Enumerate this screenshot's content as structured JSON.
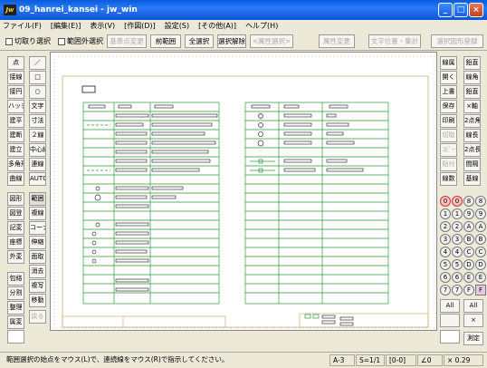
{
  "title": "09_hanrei_kansei - jw_win",
  "app_icon": "Jw",
  "window_buttons": {
    "minimize": "_",
    "maximize": "□",
    "close": "×"
  },
  "menu": [
    "ファイル(F)",
    "[編集(E)]",
    "表示(V)",
    "[作図(D)]",
    "設定(S)",
    "[その他(A)]",
    "ヘルプ(H)"
  ],
  "toolbar": {
    "cut_chk": "切取り選択",
    "outside_chk": "範囲外選択",
    "base_change": "基準点変更",
    "prev_range": "前範囲",
    "select_all": "全選択",
    "clear_sel": "選択解除",
    "attr_sel": "<属性選択>",
    "attr_change": "属性変更",
    "text_pos": "文字位置・集計",
    "sel_fig_reg": "選択図形登録"
  },
  "left_tools": [
    [
      "点",
      "／"
    ],
    [
      "接線",
      "□"
    ],
    [
      "接円",
      "○"
    ],
    [
      "ハッチ",
      "文字"
    ],
    [
      "建平",
      "寸法"
    ],
    [
      "建断",
      "２線"
    ],
    [
      "建立",
      "中心線"
    ],
    [
      "多角形",
      "連線"
    ],
    [
      "曲線",
      "AUTO"
    ],
    [
      "図形",
      "範囲"
    ],
    [
      "図登",
      "複線"
    ],
    [
      "記変",
      "コーナー"
    ],
    [
      "座標",
      "伸縮"
    ],
    [
      "外変",
      "面取"
    ],
    [
      "",
      "消去"
    ],
    [
      "包絡",
      "複写"
    ],
    [
      "分割",
      "移動"
    ],
    [
      "整理",
      "戻る"
    ],
    [
      "属変",
      ""
    ]
  ],
  "right_tools": [
    [
      "線属",
      "鉛直"
    ],
    [
      "開く",
      "線角"
    ],
    [
      "上書",
      "鉛直"
    ],
    [
      "保存",
      "×軸"
    ],
    [
      "印刷",
      "2点角"
    ],
    [
      "切取",
      "線長"
    ],
    [
      "ｺﾋﾟｰ",
      "2点長"
    ],
    [
      "貼付",
      "間隔"
    ],
    [
      "線数",
      "基線"
    ]
  ],
  "right_lower": {
    "all": "All",
    "x": "×",
    "sokutei": "測定",
    "layers": [
      "0",
      "1",
      "2",
      "3",
      "4",
      "5",
      "6",
      "7",
      "8",
      "9",
      "A",
      "B",
      "C",
      "D",
      "E",
      "F"
    ]
  },
  "status": {
    "message": "範囲選択の始点をマウス(L)で、連続線をマウス(R)で指示してください。",
    "paper": "A-3",
    "scale": "S=1/1",
    "layer": "[0-0]",
    "angle": "∠0",
    "zoom": "× 0.29"
  }
}
